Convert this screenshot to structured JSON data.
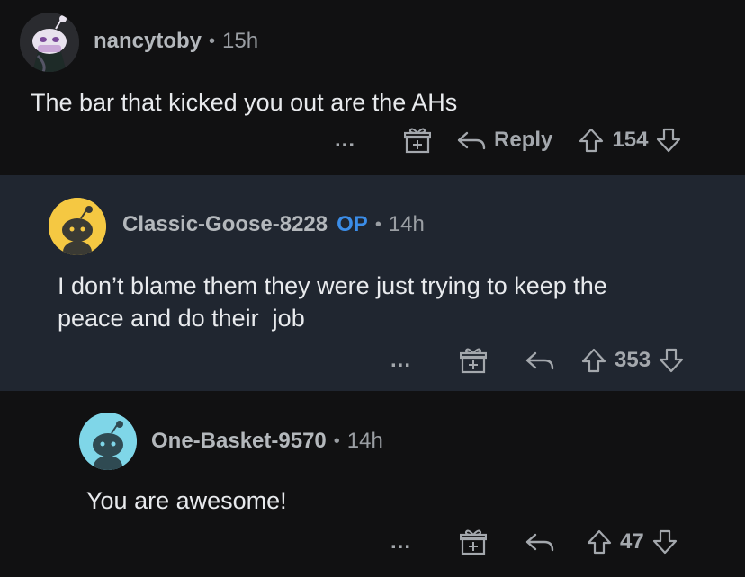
{
  "comments": [
    {
      "username": "nancytoby",
      "op": "",
      "time": "15h",
      "text": "The bar that kicked you out are the AHs",
      "reply_label": "Reply",
      "votes": "154",
      "more": "..."
    },
    {
      "username": "Classic-Goose-8228",
      "op": "OP",
      "time": "14h",
      "text": "I don’t blame them they were just trying to keep the\npeace and do their  job",
      "reply_label": "",
      "votes": "353",
      "more": "..."
    },
    {
      "username": "One-Basket-9570",
      "op": "",
      "time": "14h",
      "text": "You are awesome!",
      "reply_label": "",
      "votes": "47",
      "more": "..."
    }
  ],
  "separator": "•",
  "colors": {
    "background": "#111112",
    "highlight": "#202630",
    "op": "#3b8de8",
    "muted": "#a4a8ad"
  },
  "icons": [
    "snoo-avatar-icon",
    "award-gift-icon",
    "reply-arrow-icon",
    "upvote-arrow-icon",
    "downvote-arrow-icon"
  ]
}
